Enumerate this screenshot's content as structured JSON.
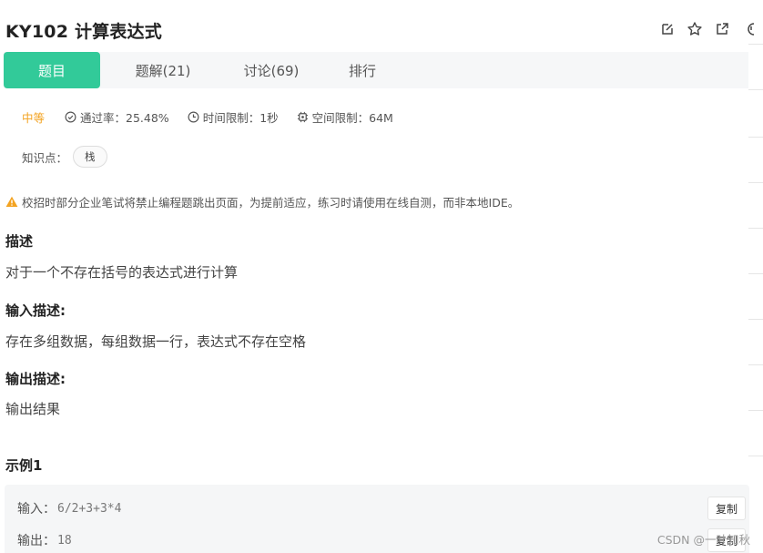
{
  "problem": {
    "title": "KY102  计算表达式"
  },
  "tabs": [
    {
      "label": "题目"
    },
    {
      "label": "题解(21)"
    },
    {
      "label": "讨论(69)"
    },
    {
      "label": "排行"
    }
  ],
  "meta": {
    "difficulty": "中等",
    "pass_rate": "通过率：25.48%",
    "time_limit": "时间限制：1秒",
    "memory_limit": "空间限制：64M"
  },
  "knowledge": {
    "label": "知识点：",
    "tag": "栈"
  },
  "warning": "校招时部分企业笔试将禁止编程题跳出页面，为提前适应，练习时请使用在线自测，而非本地IDE。",
  "sections": {
    "desc_heading": "描述",
    "desc_text": "对于一个不存在括号的表达式进行计算",
    "input_heading": "输入描述:",
    "input_text": "存在多组数据，每组数据一行，表达式不存在空格",
    "output_heading": "输出描述:",
    "output_text": "输出结果"
  },
  "example": {
    "heading": "示例1",
    "input_label": "输入：",
    "input_value": "6/2+3+3*4",
    "output_label": "输出：",
    "output_value": "18",
    "copy_label": "复制"
  },
  "watermark": "CSDN @一叶知秋",
  "colors": {
    "accent": "#32ca99",
    "difficulty": "#f3a321",
    "warning": "#f3a321"
  }
}
